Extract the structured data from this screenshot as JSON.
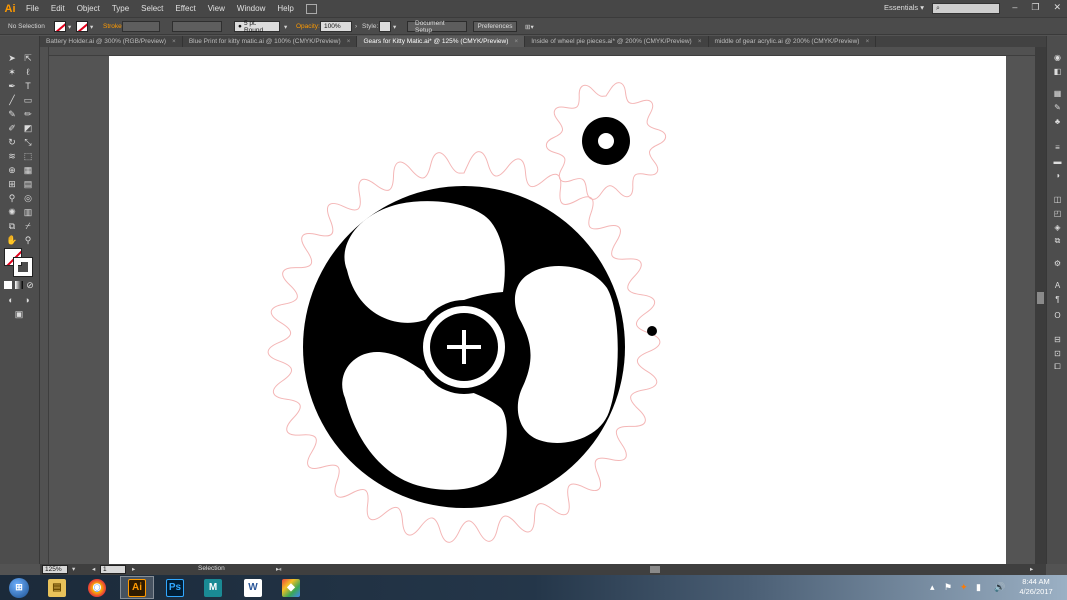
{
  "app": {
    "logo": "Ai",
    "accent": "#ff9a00"
  },
  "menu": [
    "File",
    "Edit",
    "Object",
    "Type",
    "Select",
    "Effect",
    "View",
    "Window",
    "Help"
  ],
  "workspace": {
    "label": "Essentials",
    "arrow": "▾",
    "search_placeholder": ""
  },
  "window_controls": {
    "minimize": "–",
    "restore": "❐",
    "close": "✕"
  },
  "control_bar": {
    "selection_label": "No Selection",
    "stroke_label": "Stroke",
    "stroke_weight": "",
    "brush": "5 pt. Round",
    "opacity_label": "Opacity:",
    "opacity_value": "100%",
    "style_label": "Style:",
    "document_setup": "Document Setup",
    "preferences": "Preferences"
  },
  "tabs": [
    {
      "label": "Battery Holder.ai @ 300% (RGB/Preview)",
      "active": false
    },
    {
      "label": "Blue Print for kitty matic.ai @ 100% (CMYK/Preview)",
      "active": false
    },
    {
      "label": "Gears for Kitty Matic.ai* @ 125% (CMYK/Preview)",
      "active": true
    },
    {
      "label": "Inside of wheel pie pieces.ai* @ 200% (CMYK/Preview)",
      "active": false
    },
    {
      "label": "middle of gear acrylic.ai @ 200% (CMYK/Preview)",
      "active": false
    }
  ],
  "tab_close": "×",
  "tools": [
    "selection-tool",
    "direct-selection-tool",
    "magic-wand-tool",
    "lasso-tool",
    "pen-tool",
    "type-tool",
    "line-tool",
    "rectangle-tool",
    "paintbrush-tool",
    "pencil-tool",
    "blob-brush-tool",
    "eraser-tool",
    "rotate-tool",
    "scale-tool",
    "warp-tool",
    "free-transform-tool",
    "shape-builder-tool",
    "perspective-grid-tool",
    "mesh-tool",
    "gradient-tool",
    "eyedropper-tool",
    "blend-tool",
    "symbol-sprayer-tool",
    "column-graph-tool",
    "artboard-tool",
    "slice-tool",
    "hand-tool",
    "zoom-tool"
  ],
  "status_bar": {
    "zoom": "125%",
    "artboard_number": "1",
    "mode": "Selection"
  },
  "colors": {
    "gear_outline": "#f4b6b6",
    "gear_fill": "#000000",
    "fill_none_slash": "#e0001b"
  },
  "taskbar": {
    "apps": [
      {
        "name": "start",
        "glyph": "⊞"
      },
      {
        "name": "file-explorer",
        "glyph": "▤"
      },
      {
        "name": "chrome",
        "glyph": "◉"
      },
      {
        "name": "illustrator",
        "glyph": "Ai"
      },
      {
        "name": "photoshop",
        "glyph": "Ps"
      },
      {
        "name": "maya",
        "glyph": "M"
      },
      {
        "name": "word",
        "glyph": "W"
      },
      {
        "name": "other-app",
        "glyph": "◆"
      }
    ],
    "time": "8:44 AM",
    "date": "4/26/2017"
  }
}
